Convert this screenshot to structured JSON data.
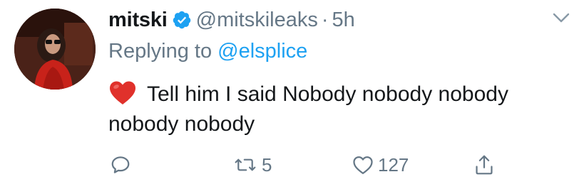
{
  "tweet": {
    "display_name": "mitski",
    "verified_icon": "verified-badge-icon",
    "handle": "@mitskileaks",
    "separator": "·",
    "timestamp": "5h",
    "replying_prefix": "Replying to ",
    "replying_to": "@elsplice",
    "emoji": "red-heart-emoji",
    "text": "Tell him I said Nobody nobody nobody nobody nobody"
  },
  "actions": {
    "reply": {
      "icon": "reply-icon",
      "count": ""
    },
    "retweet": {
      "icon": "retweet-icon",
      "count": "5"
    },
    "like": {
      "icon": "like-icon",
      "count": "127"
    },
    "share": {
      "icon": "share-icon",
      "count": ""
    }
  },
  "colors": {
    "text": "#14171a",
    "secondary": "#657786",
    "link": "#1da1f2",
    "verified": "#1da1f2",
    "heart_emoji": "#e0312b"
  }
}
